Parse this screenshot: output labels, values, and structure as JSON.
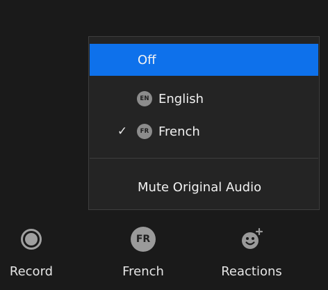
{
  "menu": {
    "items": [
      {
        "label": "Off",
        "selected": true,
        "checked": false,
        "badge": ""
      },
      {
        "label": "English",
        "selected": false,
        "checked": false,
        "badge": "EN"
      },
      {
        "label": "French",
        "selected": false,
        "checked": true,
        "badge": "FR"
      }
    ],
    "check_glyph": "✓",
    "mute_label": "Mute Original Audio"
  },
  "toolbar": {
    "record_label": "Record",
    "language_label": "French",
    "language_badge": "FR",
    "reactions_label": "Reactions"
  },
  "colors": {
    "selected_bg": "#0e71eb",
    "menu_bg": "#242424",
    "page_bg": "#1a1a1a",
    "icon_gray": "#9a9a9a"
  },
  "icons": {
    "record": "record-icon",
    "language": "language-badge-icon",
    "reactions": "add-reaction-icon",
    "check": "check-icon"
  }
}
